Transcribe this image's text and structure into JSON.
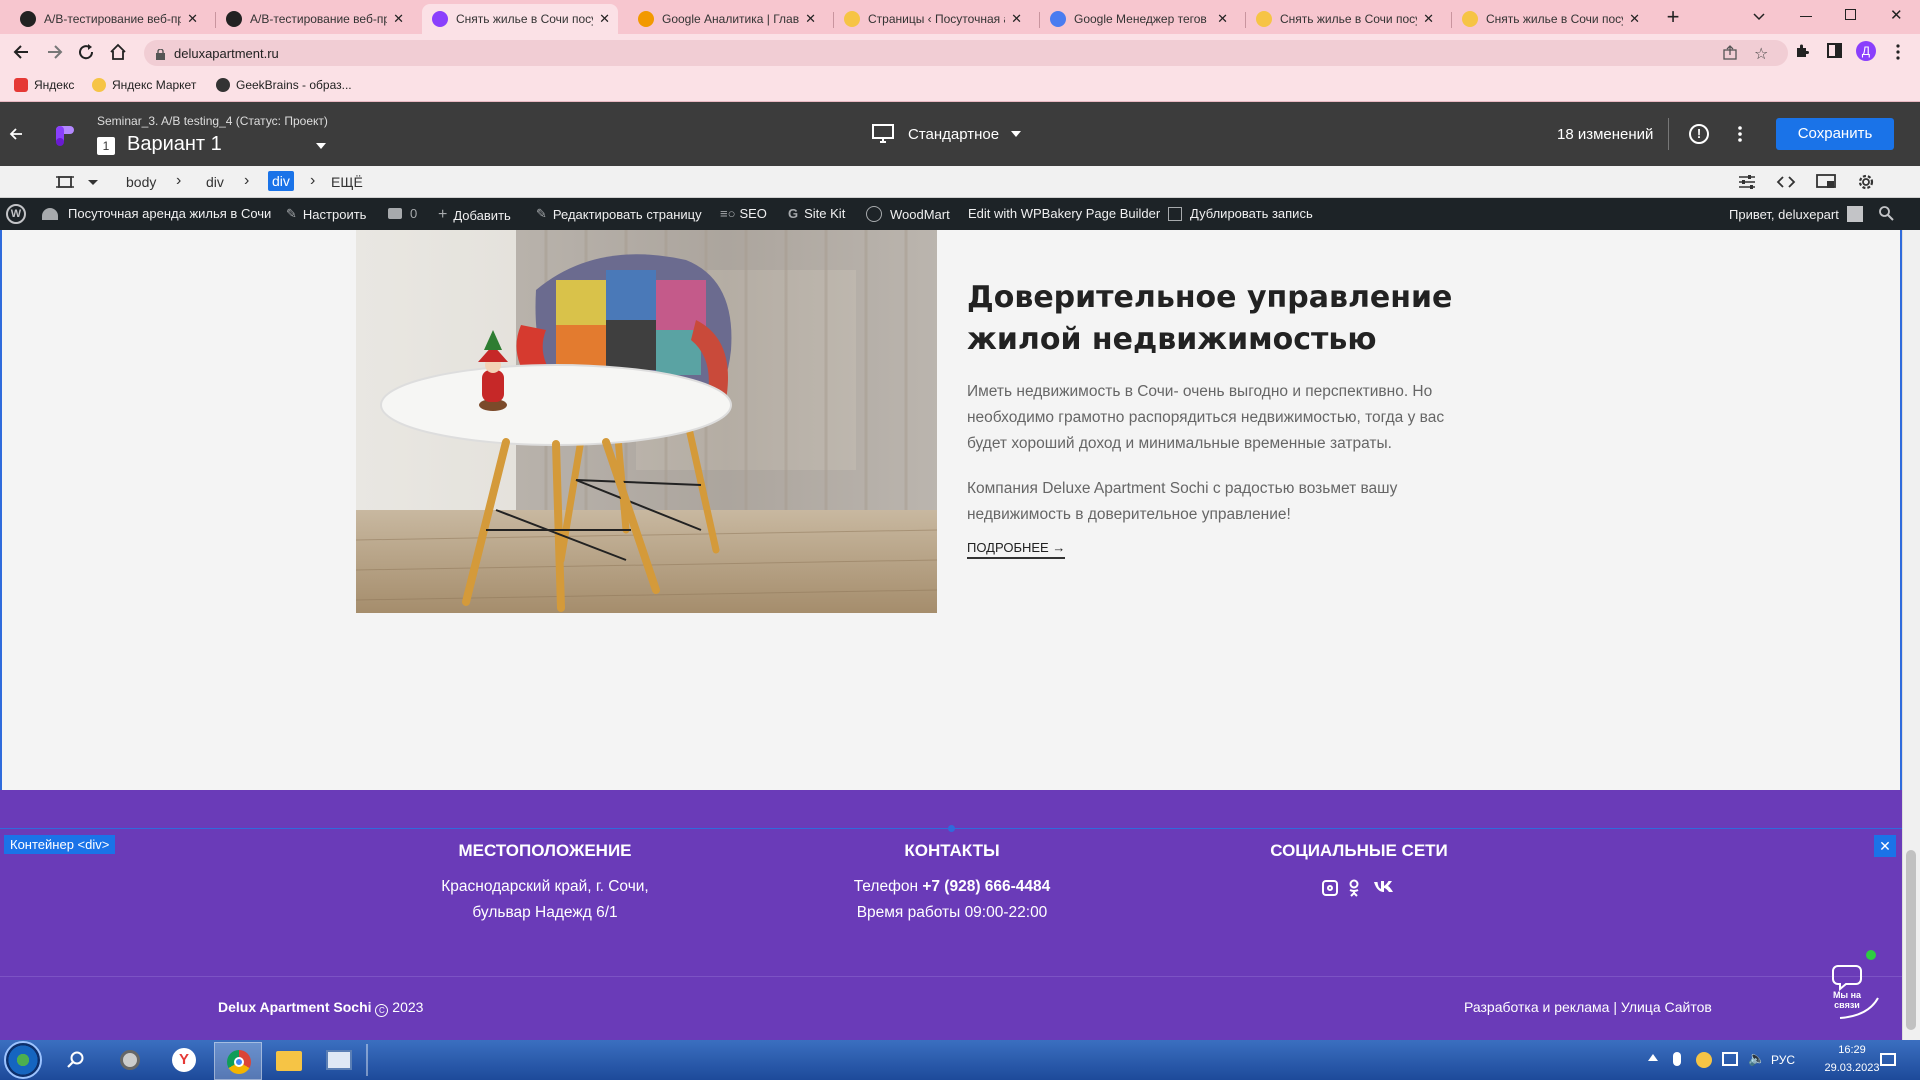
{
  "browser": {
    "tabs": [
      {
        "title": "A/B-тестирование веб-пр",
        "favicon_color": "#222222"
      },
      {
        "title": "A/B-тестирование веб-пр",
        "favicon_color": "#222222"
      },
      {
        "title": "Снять жилье в Сочи посу",
        "favicon_color": "#8a3ffc",
        "active": true
      },
      {
        "title": "Google Аналитика | Главн",
        "favicon_color": "#f29900"
      },
      {
        "title": "Страницы ‹ Посуточная а",
        "favicon_color": "#f6c445"
      },
      {
        "title": "Google Менеджер тегов",
        "favicon_color": "#4a7cf0"
      },
      {
        "title": "Снять жилье в Сочи посу",
        "favicon_color": "#f6c445"
      },
      {
        "title": "Снять жилье в Сочи посу",
        "favicon_color": "#f6c445"
      }
    ],
    "tab_close": "✕",
    "new_tab": "+",
    "url": "deluxapartment.ru",
    "profile_letter": "Д",
    "bookmarks": [
      {
        "label": "Яндекс",
        "color": "#e53935"
      },
      {
        "label": "Яндекс Маркет",
        "color": "#f6c445"
      },
      {
        "label": "GeekBrains - образ...",
        "color": "#333333"
      }
    ]
  },
  "editor": {
    "experiment": "Seminar_3. A/B testing_4 (Статус: Проект)",
    "variant_number": "1",
    "variant_name": "Вариант 1",
    "device": "Стандартное",
    "changes": "18 изменений",
    "save_label": "Сохранить",
    "breadcrumb": [
      "body",
      "div",
      "div",
      "ЕЩЁ"
    ]
  },
  "wpbar": {
    "site_name": "Посуточная аренда жилья в Сочи",
    "customize": "Настроить",
    "comments": "0",
    "add": "Добавить",
    "edit_page": "Редактировать страницу",
    "seo": "SEO",
    "sitekit": "Site Kit",
    "woodmart": "WoodMart",
    "wpbakery": "Edit with WPBakery Page Builder",
    "duplicate": "Дублировать запись",
    "greeting": "Привет, deluxepart"
  },
  "section": {
    "heading": "Доверительное управление жилой недвижимостью",
    "para1": "Иметь недвижимость в Сочи- очень выгодно и перспективно. Но необходимо грамотно распорядиться недвижимостью, тогда у вас будет хороший доход и минимальные временные затраты.",
    "para2": "Компания Deluxe Apartment Sochi с радостью возьмет вашу недвижимость в доверительное управление!",
    "more": "ПОДРОБНЕЕ →"
  },
  "footer": {
    "container_label": "Контейнер <div>",
    "location_title": "МЕСТОПОЛОЖЕНИЕ",
    "location_line1": "Краснодарский край, г. Сочи,",
    "location_line2": "бульвар Надежд 6/1",
    "contacts_title": "КОНТАКТЫ",
    "phone_label": "Телефон ",
    "phone": "+7 (928) 666-4484",
    "hours": "Время работы 09:00-22:00",
    "social_title": "СОЦИАЛЬНЫЕ СЕТИ",
    "copyright_brand": "Delux Apartment Sochi",
    "copyright_year": " 2023",
    "credit": "Разработка и реклама | Улица Сайтов",
    "chat_label": "Мы на связи"
  },
  "taskbar": {
    "lang": "РУС",
    "time": "16:29",
    "date": "29.03.2023"
  },
  "colors": {
    "accent": "#1a73e8",
    "footer": "#6a3bb8",
    "wpbar": "#1d2327"
  }
}
